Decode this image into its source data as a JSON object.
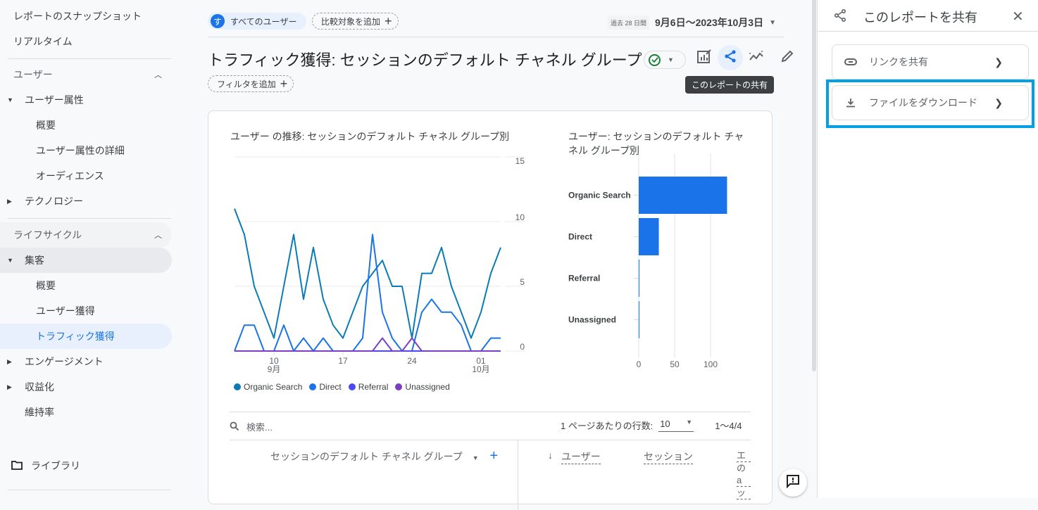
{
  "sidebar": {
    "top_items": [
      "レポートのスナップショット",
      "リアルタイム"
    ],
    "section_user": {
      "label": "ユーザー",
      "groups": [
        {
          "label": "ユーザー属性",
          "expanded": true,
          "children": [
            "概要",
            "ユーザー属性の詳細",
            "オーディエンス"
          ]
        },
        {
          "label": "テクノロジー",
          "expanded": false
        }
      ]
    },
    "section_lifecycle": {
      "label": "ライフサイクル",
      "groups": [
        {
          "label": "集客",
          "expanded": true,
          "children": [
            "概要",
            "ユーザー獲得",
            "トラフィック獲得"
          ]
        },
        {
          "label": "エンゲージメント",
          "expanded": false
        },
        {
          "label": "収益化",
          "expanded": false
        },
        {
          "label": "維持率",
          "expanded": false
        }
      ]
    },
    "library_label": "ライブラリ",
    "active_item": "トラフィック獲得"
  },
  "header": {
    "segment_avatar": "す",
    "segment_label": "すべてのユーザー",
    "add_comparison_label": "比較対象を追加",
    "date_badge": "過去 28 日間",
    "date_range": "9月6日〜2023年10月3日",
    "page_title": "トラフィック獲得: セッションのデフォルト チャネル グループ",
    "add_filter_label": "フィルタを追加",
    "share_tooltip": "このレポートの共有"
  },
  "line_chart": {
    "title": "ユーザー の推移: セッションのデフォルト チャネル グループ別"
  },
  "bar_chart": {
    "title_line1": "ユーザー: セッションのデフォルト チャ",
    "title_line2": "ネル グループ別"
  },
  "chart_data": [
    {
      "type": "line",
      "title": "ユーザー の推移: セッションのデフォルト チャネル グループ別",
      "x": [
        "09-06",
        "09-07",
        "09-08",
        "09-09",
        "09-10",
        "09-11",
        "09-12",
        "09-13",
        "09-14",
        "09-15",
        "09-16",
        "09-17",
        "09-18",
        "09-19",
        "09-20",
        "09-21",
        "09-22",
        "09-23",
        "09-24",
        "09-25",
        "09-26",
        "09-27",
        "09-28",
        "09-29",
        "09-30",
        "10-01",
        "10-02",
        "10-03"
      ],
      "x_tick_labels": [
        {
          "index": 4,
          "label": "10",
          "sub": "9月"
        },
        {
          "index": 11,
          "label": "17",
          "sub": ""
        },
        {
          "index": 18,
          "label": "24",
          "sub": ""
        },
        {
          "index": 25,
          "label": "01",
          "sub": "10月"
        }
      ],
      "ylim": [
        0,
        15
      ],
      "y_ticks": [
        0,
        5,
        10,
        15
      ],
      "y_axis_side": "right",
      "grid": true,
      "legend_position": "bottom",
      "series": [
        {
          "name": "Organic Search",
          "color": "#0b7bb5",
          "values": [
            11,
            9,
            5,
            3,
            1,
            5,
            9,
            4,
            8,
            4,
            2,
            1,
            3,
            5,
            6,
            7,
            5,
            5,
            1,
            6,
            6,
            8,
            5,
            3,
            1,
            3,
            6,
            8
          ]
        },
        {
          "name": "Direct",
          "color": "#1a73e8",
          "values": [
            0,
            2,
            2,
            0,
            0,
            2,
            0,
            1,
            0,
            1,
            0,
            0,
            0,
            1,
            9,
            3,
            1,
            0,
            0,
            3,
            4,
            3,
            3,
            2,
            0,
            0,
            1,
            1
          ]
        },
        {
          "name": "Referral",
          "color": "#4a4af0",
          "values": [
            0,
            0,
            0,
            0,
            0,
            0,
            0,
            0,
            0,
            0,
            0,
            0,
            0,
            0,
            0,
            0,
            0,
            0,
            0,
            0,
            0,
            0,
            0,
            0,
            0,
            0,
            0,
            0
          ]
        },
        {
          "name": "Unassigned",
          "color": "#7b3fc6",
          "values": [
            0,
            0,
            0,
            0,
            0,
            0,
            0,
            0,
            0,
            0,
            0,
            0,
            0,
            0,
            0,
            1,
            0,
            0,
            1,
            0,
            0,
            0,
            0,
            0,
            0,
            0,
            0,
            0
          ]
        }
      ]
    },
    {
      "type": "bar",
      "orientation": "horizontal",
      "title": "ユーザー: セッションのデフォルト チャネル グループ別",
      "categories": [
        "Organic Search",
        "Direct",
        "Referral",
        "Unassigned"
      ],
      "values": [
        123,
        28,
        1,
        1
      ],
      "color": "#1a73e8",
      "xlim": [
        0,
        150
      ],
      "x_ticks": [
        0,
        50,
        100
      ],
      "grid": true
    }
  ],
  "table": {
    "search_placeholder": "検索...",
    "rows_per_page_label": "1 ページあたりの行数:",
    "rows_per_page_value": "10",
    "pagination": "1〜4/4",
    "dimension_header": "セッションのデフォルト チャネル グループ",
    "columns": [
      "ユーザー",
      "セッション",
      "エンゲージのあったセッション"
    ],
    "truncated_column_lines": [
      "エ",
      "のa",
      "ッ"
    ]
  },
  "share_panel": {
    "title": "このレポートを共有",
    "options": [
      {
        "label": "リンクを共有",
        "icon": "link-icon"
      },
      {
        "label": "ファイルをダウンロード",
        "icon": "download-icon",
        "highlighted": true
      }
    ]
  }
}
